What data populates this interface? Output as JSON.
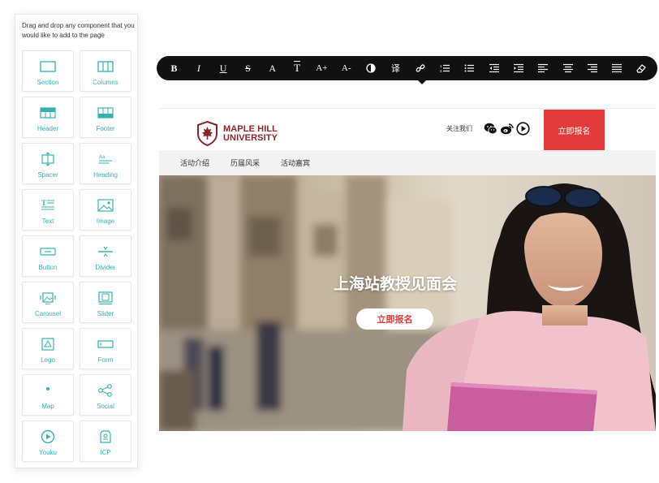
{
  "sidebar": {
    "hint": "Drag and drop any component that you would like to add to the page",
    "components": [
      {
        "label": "Section",
        "icon": "section-icon"
      },
      {
        "label": "Columns",
        "icon": "columns-icon"
      },
      {
        "label": "Header",
        "icon": "header-icon"
      },
      {
        "label": "Footer",
        "icon": "footer-icon"
      },
      {
        "label": "Spacer",
        "icon": "spacer-icon"
      },
      {
        "label": "Heading",
        "icon": "heading-icon"
      },
      {
        "label": "Text",
        "icon": "text-icon"
      },
      {
        "label": "Image",
        "icon": "image-icon"
      },
      {
        "label": "Button",
        "icon": "button-icon"
      },
      {
        "label": "Divider",
        "icon": "divider-icon"
      },
      {
        "label": "Carousel",
        "icon": "carousel-icon"
      },
      {
        "label": "Slider",
        "icon": "slider-icon"
      },
      {
        "label": "Logo",
        "icon": "logo-icon"
      },
      {
        "label": "Form",
        "icon": "form-icon"
      },
      {
        "label": "Map",
        "icon": "map-pin-icon"
      },
      {
        "label": "Social",
        "icon": "share-icon"
      },
      {
        "label": "Youku",
        "icon": "play-circle-icon"
      },
      {
        "label": "ICP",
        "icon": "icp-badge-icon"
      }
    ],
    "accent_color": "#37b0b0"
  },
  "toolbar": {
    "tools": [
      {
        "name": "bold",
        "glyph": "B"
      },
      {
        "name": "italic",
        "glyph": "I"
      },
      {
        "name": "underline",
        "glyph": "U"
      },
      {
        "name": "strikethrough",
        "glyph": "S"
      },
      {
        "name": "font-size",
        "glyph": "A"
      },
      {
        "name": "text-style",
        "glyph": "T"
      },
      {
        "name": "increase-font",
        "glyph": "A+"
      },
      {
        "name": "decrease-font",
        "glyph": "A-"
      },
      {
        "name": "color"
      },
      {
        "name": "translate",
        "glyph": "译"
      },
      {
        "name": "link"
      },
      {
        "name": "ordered-list"
      },
      {
        "name": "unordered-list"
      },
      {
        "name": "outdent"
      },
      {
        "name": "indent"
      },
      {
        "name": "align-left"
      },
      {
        "name": "align-center"
      },
      {
        "name": "align-right"
      },
      {
        "name": "justify"
      },
      {
        "name": "clear-format"
      }
    ]
  },
  "site": {
    "brand": {
      "line1": "MAPLE HILL",
      "line2": "UNIVERSITY",
      "color": "#8a2429"
    },
    "follow_label": "关注我们",
    "social": [
      "wechat-icon",
      "weibo-icon",
      "play-icon"
    ],
    "register_label": "立即报名",
    "nav": [
      "活动介绍",
      "历届风采",
      "活动嘉宾"
    ],
    "hero": {
      "title": "上海站教授见面会",
      "button": "立即报名"
    },
    "brand_red": "#e23b3b"
  }
}
